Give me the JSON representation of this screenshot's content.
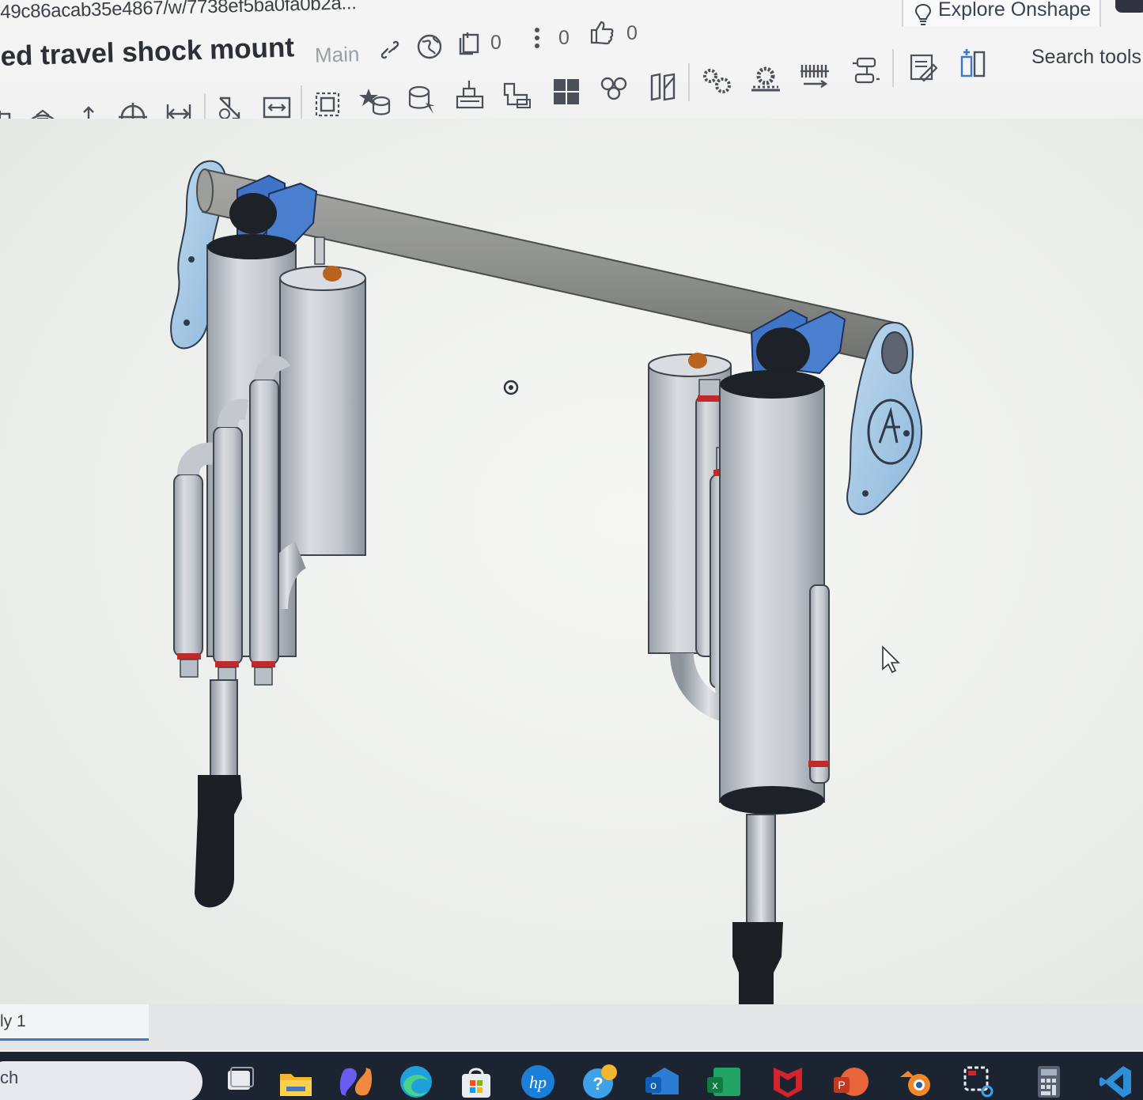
{
  "browser": {
    "url_fragment": "49c86acab35e4867/w/7738ef5ba0fa0b2a..."
  },
  "header": {
    "explore_label": "Explore Onshape",
    "doc_title": "ed travel shock mount",
    "branch": "Main",
    "versions_count": "0",
    "info_count": "0",
    "likes_count": "0",
    "search_label": "Search tools"
  },
  "toolbar": {
    "tools": [
      "sketch-icon",
      "revolve-icon",
      "sweep-icon",
      "mate-connector-icon",
      "linear-pattern-icon",
      "transform-icon",
      "dimension-icon",
      "section-view-icon",
      "fastened-mate-icon",
      "revolute-mate-icon",
      "slider-mate-icon",
      "cylindrical-mate-icon",
      "planar-mate-icon",
      "ball-mate-icon",
      "parallel-mate-icon",
      "gear-relation-icon",
      "rack-pinion-icon",
      "screw-relation-icon",
      "linear-relation-icon",
      "animate-icon",
      "explode-icon"
    ]
  },
  "tabs": {
    "active_label": "ly 1"
  },
  "taskbar": {
    "search_label": "ch",
    "apps": [
      "task-view-icon",
      "file-explorer-icon",
      "copilot-icon",
      "edge-icon",
      "store-icon",
      "hp-icon",
      "help-icon",
      "outlook-icon",
      "excel-icon",
      "mcafee-icon",
      "powerpoint-icon",
      "blender-icon",
      "snipping-tool-icon",
      "calculator-icon",
      "vscode-icon"
    ]
  },
  "colors": {
    "accent": "#3e78c8",
    "model_blue": "#4a7fd0",
    "model_gray": "#b9bfc6",
    "viewport_bg": "#eef0ee",
    "taskbar_bg": "#1c2331"
  }
}
